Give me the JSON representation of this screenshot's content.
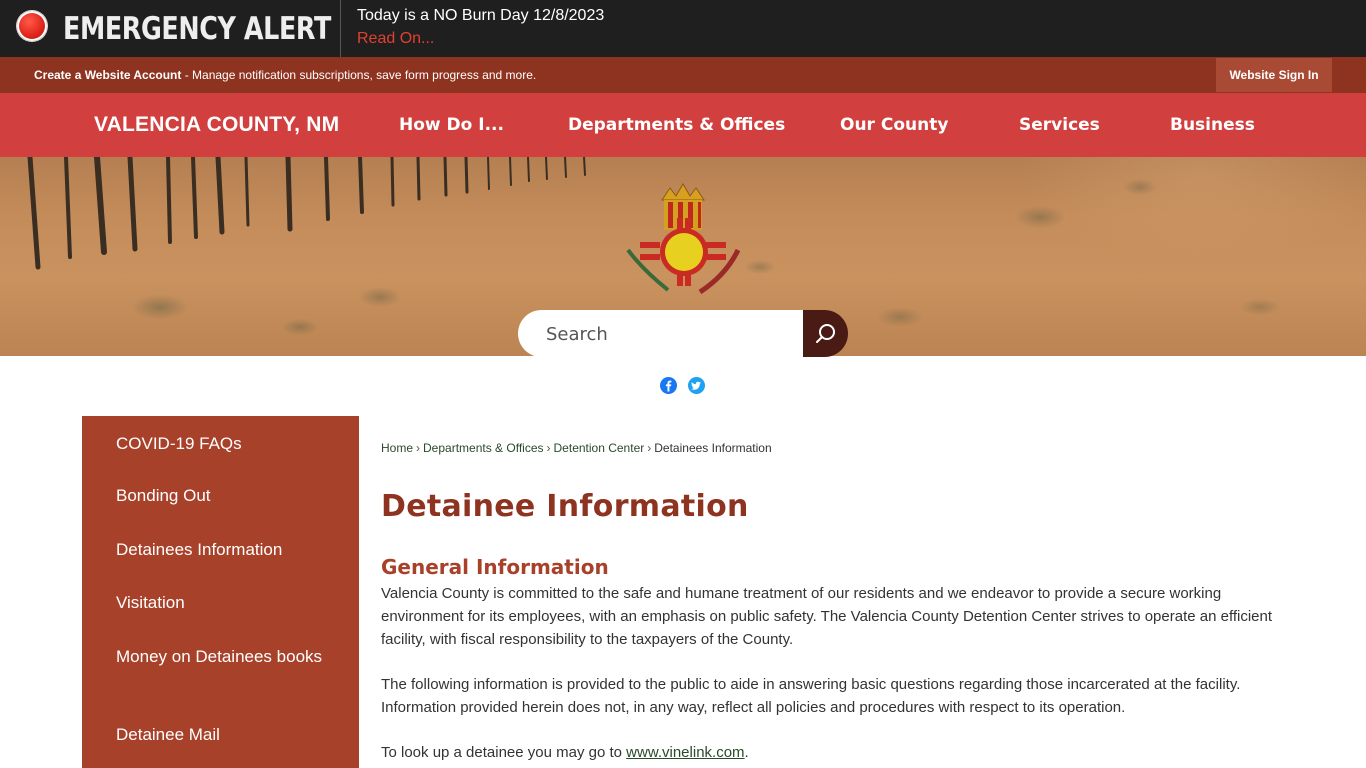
{
  "alert": {
    "title": "EMERGENCY ALERT",
    "message": "Today is a NO Burn Day 12/8/2023",
    "link": "Read On..."
  },
  "account": {
    "create_label": "Create a Website Account",
    "create_desc": " - Manage notification subscriptions, save form progress and more.",
    "signin_label": "Website Sign In"
  },
  "nav": {
    "site_title": "VALENCIA COUNTY, NM",
    "items": [
      "How Do I...",
      "Departments & Offices",
      "Our County",
      "Services",
      "Business"
    ]
  },
  "search": {
    "placeholder": "Search"
  },
  "social": {
    "icons": [
      "facebook-icon",
      "twitter-icon"
    ]
  },
  "sidebar": {
    "items": [
      "COVID-19 FAQs",
      "Bonding Out",
      "Detainees Information",
      "Visitation",
      "Money on Detainees books",
      "Detainee Mail"
    ]
  },
  "breadcrumb": {
    "items": [
      "Home",
      "Departments & Offices",
      "Detention Center",
      "Detainees Information"
    ],
    "separator": "›"
  },
  "content": {
    "title": "Detainee Information",
    "section_title": "General Information",
    "para1": "Valencia County is committed to the safe and humane treatment of our residents and we endeavor to provide a secure working environment for its employees, with an emphasis on public safety. The Valencia County Detention Center strives to operate an efficient facility, with fiscal responsibility to the taxpayers of the County.",
    "para2": "The following information is provided to the public to aide in answering basic questions regarding those incarcerated at the facility. Information provided herein does not, in any way, reflect all policies and procedures with respect to its operation.",
    "para3_prefix": "To look up a detainee you may go to ",
    "para3_link": "www.vinelink.com",
    "para3_suffix": "."
  },
  "colors": {
    "alert_bg": "#1f1f1f",
    "account_bg": "#8e3320",
    "nav_bg": "#d23f3f",
    "sidebar_bg": "#a8412a",
    "title_color": "#8e3320",
    "link_red": "#e0412f"
  }
}
